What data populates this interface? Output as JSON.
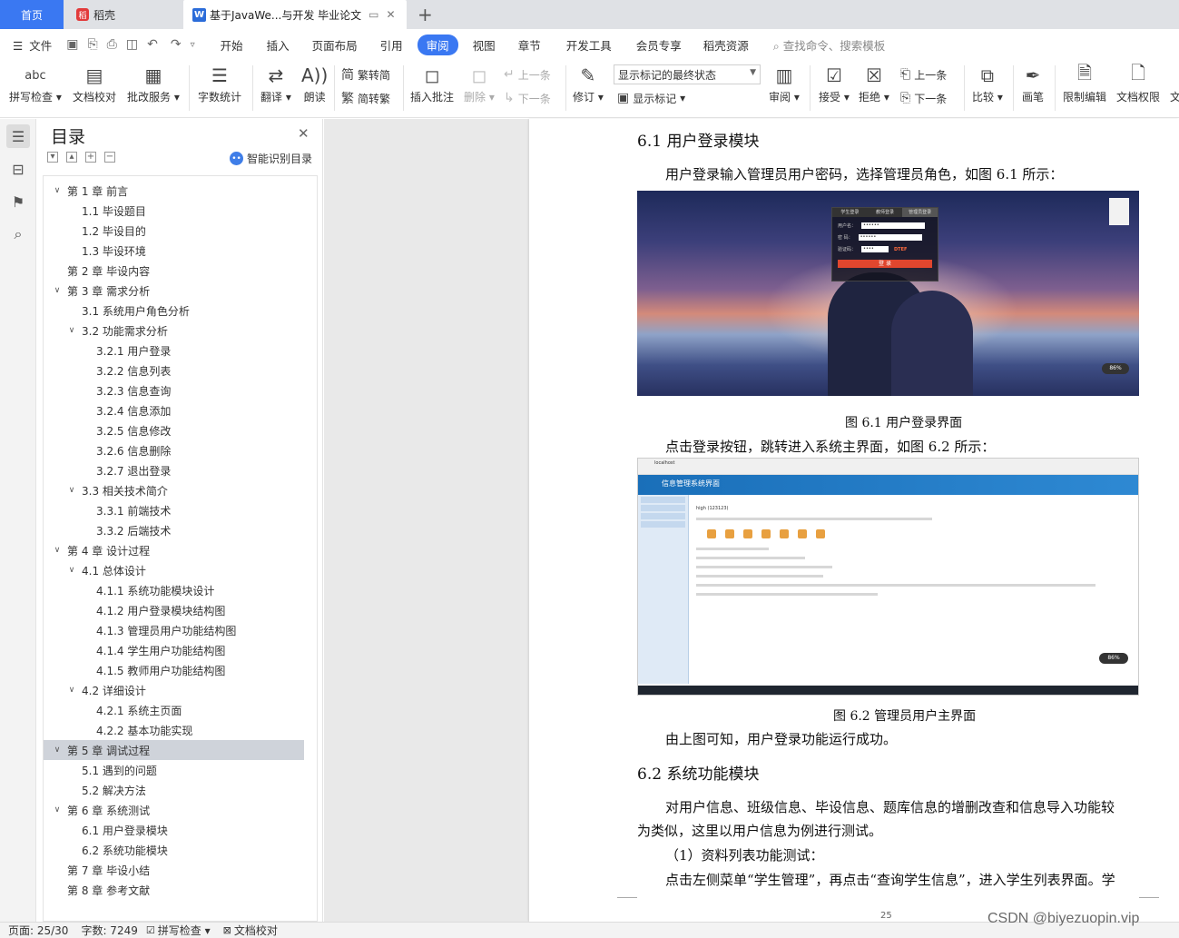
{
  "tabs": {
    "home": "首页",
    "shell": "稻壳",
    "doc": "基于JavaWe...与开发 毕业论文",
    "add": "+"
  },
  "menu": {
    "file": "文件",
    "items": [
      "开始",
      "插入",
      "页面布局",
      "引用",
      "审阅",
      "视图",
      "章节",
      "开发工具",
      "会员专享",
      "稻壳资源"
    ],
    "active": "审阅",
    "search_placeholder": "查找命令、搜索模板"
  },
  "ribbon": {
    "spell_check": "拼写检查",
    "doc_proof": "文档校对",
    "annotate_service": "批改服务",
    "word_count": "字数统计",
    "translate": "翻译",
    "read_aloud": "朗读",
    "trad_to_simp": "繁转简",
    "simp_to_trad": "简转繁",
    "insert_comment": "插入批注",
    "delete": "删除",
    "prev_comment": "上一条",
    "next_comment": "下一条",
    "revise": "修订",
    "mark_state": "显示标记的最终状态",
    "show_marks": "显示标记",
    "review": "审阅",
    "accept": "接受",
    "reject": "拒绝",
    "prev": "上一条",
    "next": "下一条",
    "compare": "比较",
    "pen": "画笔",
    "restrict_edit": "限制编辑",
    "doc_permission": "文档权限",
    "cut_off": "文"
  },
  "toc": {
    "title": "目录",
    "smart": "智能识别目录",
    "items": [
      {
        "text": "第 1 章  前言",
        "level": 1,
        "caret": "expanded"
      },
      {
        "text": "1.1 毕设题目",
        "level": 2,
        "caret": "none"
      },
      {
        "text": "1.2 毕设目的",
        "level": 2,
        "caret": "none"
      },
      {
        "text": "1.3 毕设环境",
        "level": 2,
        "caret": "none"
      },
      {
        "text": "第 2 章  毕设内容",
        "level": 1,
        "caret": "none"
      },
      {
        "text": "第 3 章  需求分析",
        "level": 1,
        "caret": "expanded"
      },
      {
        "text": "3.1 系统用户角色分析",
        "level": 2,
        "caret": "none"
      },
      {
        "text": "3.2 功能需求分析",
        "level": 2,
        "caret": "expanded"
      },
      {
        "text": "3.2.1 用户登录",
        "level": 3,
        "caret": "none"
      },
      {
        "text": "3.2.2 信息列表",
        "level": 3,
        "caret": "none"
      },
      {
        "text": "3.2.3 信息查询",
        "level": 3,
        "caret": "none"
      },
      {
        "text": "3.2.4 信息添加",
        "level": 3,
        "caret": "none"
      },
      {
        "text": "3.2.5 信息修改",
        "level": 3,
        "caret": "none"
      },
      {
        "text": "3.2.6 信息删除",
        "level": 3,
        "caret": "none"
      },
      {
        "text": "3.2.7 退出登录",
        "level": 3,
        "caret": "none"
      },
      {
        "text": "3.3 相关技术简介",
        "level": 2,
        "caret": "expanded"
      },
      {
        "text": "3.3.1 前端技术",
        "level": 3,
        "caret": "none"
      },
      {
        "text": "3.3.2 后端技术",
        "level": 3,
        "caret": "none"
      },
      {
        "text": "第 4 章  设计过程",
        "level": 1,
        "caret": "expanded"
      },
      {
        "text": "4.1 总体设计",
        "level": 2,
        "caret": "expanded"
      },
      {
        "text": "4.1.1 系统功能模块设计",
        "level": 3,
        "caret": "none"
      },
      {
        "text": "4.1.2 用户登录模块结构图",
        "level": 3,
        "caret": "none"
      },
      {
        "text": "4.1.3 管理员用户功能结构图",
        "level": 3,
        "caret": "none"
      },
      {
        "text": "4.1.4 学生用户功能结构图",
        "level": 3,
        "caret": "none"
      },
      {
        "text": "4.1.5 教师用户功能结构图",
        "level": 3,
        "caret": "none"
      },
      {
        "text": "4.2 详细设计",
        "level": 2,
        "caret": "expanded"
      },
      {
        "text": "4.2.1 系统主页面",
        "level": 3,
        "caret": "none"
      },
      {
        "text": "4.2.2 基本功能实现",
        "level": 3,
        "caret": "none"
      },
      {
        "text": "第 5 章  调试过程",
        "level": 1,
        "caret": "expanded",
        "selected": true
      },
      {
        "text": "5.1 遇到的问题",
        "level": 2,
        "caret": "none"
      },
      {
        "text": "5.2  解决方法",
        "level": 2,
        "caret": "none"
      },
      {
        "text": "第 6 章  系统测试",
        "level": 1,
        "caret": "expanded"
      },
      {
        "text": "6.1 用户登录模块",
        "level": 2,
        "caret": "none"
      },
      {
        "text": "6.2 系统功能模块",
        "level": 2,
        "caret": "none"
      },
      {
        "text": "第 7 章  毕设小结",
        "level": 1,
        "caret": "none"
      },
      {
        "text": "第 8 章  参考文献",
        "level": 1,
        "caret": "none"
      }
    ]
  },
  "doc": {
    "h_61": "6.1 用户登录模块",
    "p1": "用户登录输入管理员用户密码，选择管理员角色，如图 6.1 所示：",
    "cap1": "图 6.1 用户登录界面",
    "p2": "点击登录按钮，跳转进入系统主界面，如图 6.2 所示：",
    "cap2": "图 6.2 管理员用户主界面",
    "p3": "由上图可知，用户登录功能运行成功。",
    "h_62": "6.2 系统功能模块",
    "p4a": "对用户信息、班级信息、毕设信息、题库信息的增删改查和信息导入功能较",
    "p4b": "为类似，这里以用户信息为例进行测试。",
    "p5": "（1）资料列表功能测试：",
    "p6": "点击左侧菜单“学生管理”，再点击“查询学生信息”，进入学生列表界面。学",
    "page_num": "25",
    "login_tabs": [
      "学生登录",
      "教师登录",
      "管理员登录"
    ],
    "login_user_label": "用户名：",
    "login_pwd_label": "密 码：",
    "login_code_label": "验证码：",
    "login_captcha": "DTEF",
    "login_btn": "登 录",
    "img2_title": "信息管理系统界面"
  },
  "status": {
    "page": "页面: 25/30",
    "words": "字数: 7249",
    "spell": "拼写检查",
    "proof": "文档校对"
  },
  "watermark": "CSDN @biyezuopin.vip"
}
